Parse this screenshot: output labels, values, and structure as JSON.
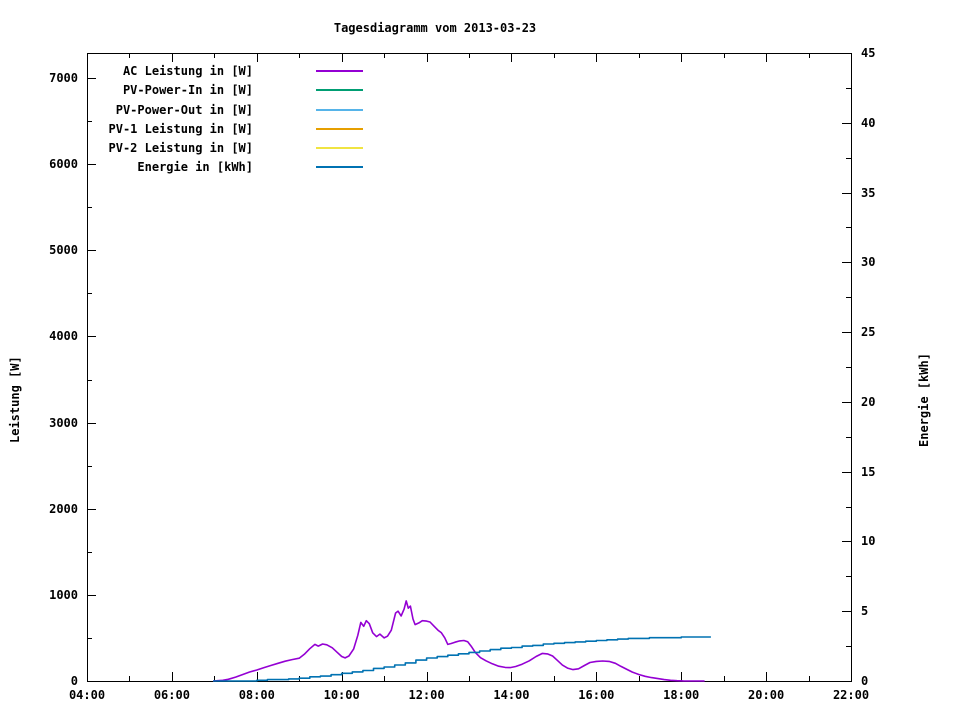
{
  "title": "Tagesdiagramm vom 2013-03-23",
  "colors": {
    "foreground": "#000000",
    "background": "#ffffff",
    "ac": "#9400D3",
    "pv_in": "#009E73",
    "pv_out": "#56B4E9",
    "pv1": "#E69F00",
    "pv2": "#F0E442",
    "energie": "#0072B2"
  },
  "chart_data": {
    "type": "line",
    "title": "Tagesdiagramm vom 2013-03-23",
    "grid": false,
    "legend_position": "top-left",
    "x_axis": {
      "unit": "time of day",
      "range_hours": [
        4,
        22
      ],
      "major_ticks": [
        {
          "hour": 4,
          "label": "04:00"
        },
        {
          "hour": 6,
          "label": "06:00"
        },
        {
          "hour": 8,
          "label": "08:00"
        },
        {
          "hour": 10,
          "label": "10:00"
        },
        {
          "hour": 12,
          "label": "12:00"
        },
        {
          "hour": 14,
          "label": "14:00"
        },
        {
          "hour": 16,
          "label": "16:00"
        },
        {
          "hour": 18,
          "label": "18:00"
        },
        {
          "hour": 20,
          "label": "20:00"
        },
        {
          "hour": 22,
          "label": "22:00"
        }
      ],
      "minor_tick_hours": [
        5,
        7,
        9,
        11,
        13,
        15,
        17,
        19,
        21
      ]
    },
    "left_axis": {
      "label": "Leistung [W]",
      "range": [
        0,
        7291
      ],
      "major_ticks": [
        0,
        1000,
        2000,
        3000,
        4000,
        5000,
        6000,
        7000
      ],
      "minor_ticks": [
        500,
        1500,
        2500,
        3500,
        4500,
        5500,
        6500
      ]
    },
    "right_axis": {
      "label": "Energie [kWh]",
      "range": [
        0,
        45
      ],
      "major_ticks": [
        0,
        5,
        10,
        15,
        20,
        25,
        30,
        35,
        40,
        45
      ],
      "minor_ticks": [
        2.5,
        7.5,
        12.5,
        17.5,
        22.5,
        27.5,
        32.5,
        37.5,
        42.5
      ]
    },
    "series": [
      {
        "id": "ac-leistung",
        "name": "AC Leistung in [W]",
        "color": "#9400D3",
        "axis": "left",
        "points": [
          [
            6.97,
            0
          ],
          [
            7.08,
            3
          ],
          [
            7.2,
            8
          ],
          [
            7.33,
            20
          ],
          [
            7.5,
            45
          ],
          [
            7.67,
            75
          ],
          [
            7.83,
            105
          ],
          [
            8.0,
            128
          ],
          [
            8.17,
            155
          ],
          [
            8.33,
            180
          ],
          [
            8.5,
            205
          ],
          [
            8.67,
            230
          ],
          [
            8.83,
            248
          ],
          [
            9.0,
            265
          ],
          [
            9.12,
            310
          ],
          [
            9.25,
            375
          ],
          [
            9.37,
            425
          ],
          [
            9.45,
            405
          ],
          [
            9.55,
            430
          ],
          [
            9.65,
            420
          ],
          [
            9.78,
            385
          ],
          [
            9.9,
            330
          ],
          [
            10.0,
            285
          ],
          [
            10.08,
            268
          ],
          [
            10.17,
            290
          ],
          [
            10.28,
            370
          ],
          [
            10.38,
            530
          ],
          [
            10.45,
            680
          ],
          [
            10.52,
            635
          ],
          [
            10.58,
            700
          ],
          [
            10.65,
            665
          ],
          [
            10.73,
            560
          ],
          [
            10.82,
            515
          ],
          [
            10.9,
            545
          ],
          [
            11.0,
            500
          ],
          [
            11.08,
            520
          ],
          [
            11.17,
            590
          ],
          [
            11.27,
            790
          ],
          [
            11.33,
            810
          ],
          [
            11.4,
            755
          ],
          [
            11.47,
            835
          ],
          [
            11.52,
            930
          ],
          [
            11.57,
            845
          ],
          [
            11.62,
            870
          ],
          [
            11.68,
            720
          ],
          [
            11.73,
            655
          ],
          [
            11.82,
            675
          ],
          [
            11.9,
            700
          ],
          [
            12.0,
            695
          ],
          [
            12.08,
            685
          ],
          [
            12.17,
            640
          ],
          [
            12.27,
            590
          ],
          [
            12.35,
            560
          ],
          [
            12.43,
            500
          ],
          [
            12.5,
            425
          ],
          [
            12.58,
            435
          ],
          [
            12.67,
            450
          ],
          [
            12.78,
            465
          ],
          [
            12.88,
            470
          ],
          [
            12.97,
            455
          ],
          [
            13.05,
            405
          ],
          [
            13.15,
            330
          ],
          [
            13.27,
            270
          ],
          [
            13.4,
            235
          ],
          [
            13.55,
            200
          ],
          [
            13.7,
            172
          ],
          [
            13.85,
            158
          ],
          [
            13.97,
            155
          ],
          [
            14.1,
            168
          ],
          [
            14.25,
            195
          ],
          [
            14.42,
            235
          ],
          [
            14.58,
            285
          ],
          [
            14.73,
            320
          ],
          [
            14.85,
            315
          ],
          [
            14.97,
            290
          ],
          [
            15.08,
            240
          ],
          [
            15.2,
            185
          ],
          [
            15.32,
            150
          ],
          [
            15.45,
            132
          ],
          [
            15.58,
            142
          ],
          [
            15.72,
            180
          ],
          [
            15.85,
            215
          ],
          [
            16.0,
            228
          ],
          [
            16.15,
            232
          ],
          [
            16.3,
            228
          ],
          [
            16.45,
            205
          ],
          [
            16.58,
            170
          ],
          [
            16.72,
            135
          ],
          [
            16.85,
            103
          ],
          [
            17.0,
            75
          ],
          [
            17.15,
            55
          ],
          [
            17.3,
            40
          ],
          [
            17.45,
            28
          ],
          [
            17.6,
            16
          ],
          [
            17.75,
            8
          ],
          [
            17.9,
            3
          ],
          [
            18.05,
            1
          ],
          [
            18.3,
            0
          ],
          [
            18.55,
            0
          ]
        ]
      },
      {
        "id": "pv-power-in",
        "name": "PV-Power-In in [W]",
        "color": "#009E73",
        "axis": "left",
        "points": []
      },
      {
        "id": "pv-power-out",
        "name": "PV-Power-Out in [W]",
        "color": "#56B4E9",
        "axis": "left",
        "points": []
      },
      {
        "id": "pv-1-leistung",
        "name": "PV-1 Leistung in [W]",
        "color": "#E69F00",
        "axis": "left",
        "points": []
      },
      {
        "id": "pv-2-leistung",
        "name": "PV-2 Leistung in [W]",
        "color": "#F0E442",
        "axis": "left",
        "points": []
      },
      {
        "id": "energie",
        "name": "Energie in [kWh]",
        "color": "#0072B2",
        "axis": "right",
        "quantize": 0.05,
        "points": [
          [
            6.97,
            0
          ],
          [
            7.3,
            0
          ],
          [
            7.6,
            0.02
          ],
          [
            8.0,
            0.05
          ],
          [
            8.25,
            0.08
          ],
          [
            8.5,
            0.12
          ],
          [
            8.75,
            0.17
          ],
          [
            9.0,
            0.22
          ],
          [
            9.25,
            0.29
          ],
          [
            9.5,
            0.36
          ],
          [
            9.75,
            0.45
          ],
          [
            10.0,
            0.55
          ],
          [
            10.25,
            0.64
          ],
          [
            10.5,
            0.75
          ],
          [
            10.75,
            0.89
          ],
          [
            11.0,
            1.02
          ],
          [
            11.25,
            1.16
          ],
          [
            11.5,
            1.32
          ],
          [
            11.75,
            1.49
          ],
          [
            12.0,
            1.63
          ],
          [
            12.25,
            1.75
          ],
          [
            12.5,
            1.85
          ],
          [
            12.75,
            1.95
          ],
          [
            13.0,
            2.06
          ],
          [
            13.25,
            2.17
          ],
          [
            13.5,
            2.27
          ],
          [
            13.75,
            2.35
          ],
          [
            14.0,
            2.42
          ],
          [
            14.25,
            2.49
          ],
          [
            14.5,
            2.56
          ],
          [
            14.75,
            2.63
          ],
          [
            15.0,
            2.69
          ],
          [
            15.25,
            2.74
          ],
          [
            15.5,
            2.79
          ],
          [
            15.75,
            2.84
          ],
          [
            16.0,
            2.89
          ],
          [
            16.25,
            2.94
          ],
          [
            16.5,
            2.99
          ],
          [
            16.75,
            3.03
          ],
          [
            17.0,
            3.06
          ],
          [
            17.25,
            3.08
          ],
          [
            17.5,
            3.1
          ],
          [
            17.75,
            3.12
          ],
          [
            18.0,
            3.13
          ],
          [
            18.3,
            3.14
          ],
          [
            18.7,
            3.15
          ]
        ]
      }
    ]
  }
}
